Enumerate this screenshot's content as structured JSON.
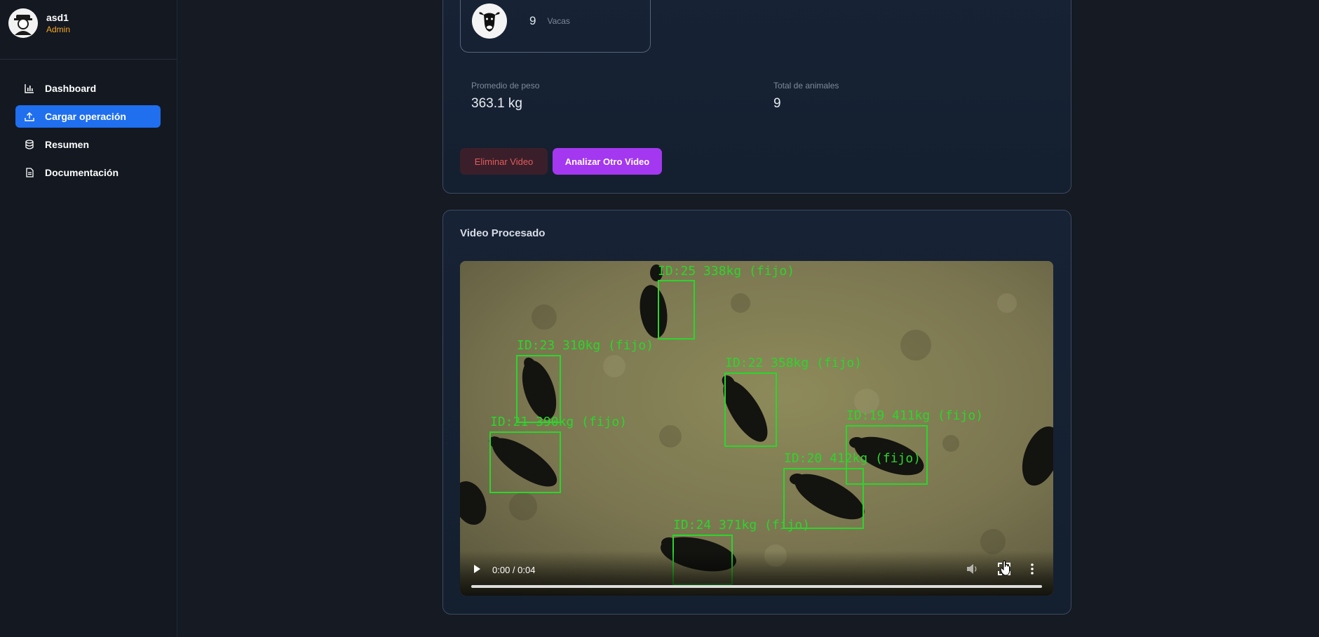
{
  "sidebar": {
    "user": {
      "name": "asd1",
      "role": "Admin"
    },
    "items": [
      {
        "label": "Dashboard",
        "icon": "bar-chart-icon",
        "active": false
      },
      {
        "label": "Cargar operación",
        "icon": "upload-icon",
        "active": true
      },
      {
        "label": "Resumen",
        "icon": "database-icon",
        "active": false
      },
      {
        "label": "Documentación",
        "icon": "document-icon",
        "active": false
      }
    ]
  },
  "summary": {
    "count": "9",
    "count_label": "Vacas",
    "stats": [
      {
        "label": "Promedio de peso",
        "value": "363.1 kg"
      },
      {
        "label": "Total de animales",
        "value": "9"
      }
    ],
    "delete_button": "Eliminar Video",
    "analyze_button": "Analizar Otro Video"
  },
  "video": {
    "title": "Video Procesado",
    "time": "0:00 / 0:04",
    "detections": [
      {
        "label": "ID:25 338kg (fijo)"
      },
      {
        "label": "ID:23 310kg (fijo)"
      },
      {
        "label": "ID:22 358kg (fijo)"
      },
      {
        "label": "ID:21 390kg (fijo)"
      },
      {
        "label": "ID:19 411kg (fijo)"
      },
      {
        "label": "ID:20 412kg (fijo)"
      },
      {
        "label": "ID:24 371kg (fijo)"
      }
    ]
  },
  "colors": {
    "accent": "#1f6fee",
    "analyze": "#a437f0",
    "danger": "#e25b5b",
    "role": "#f5a524",
    "detection": "#2bd62b"
  }
}
